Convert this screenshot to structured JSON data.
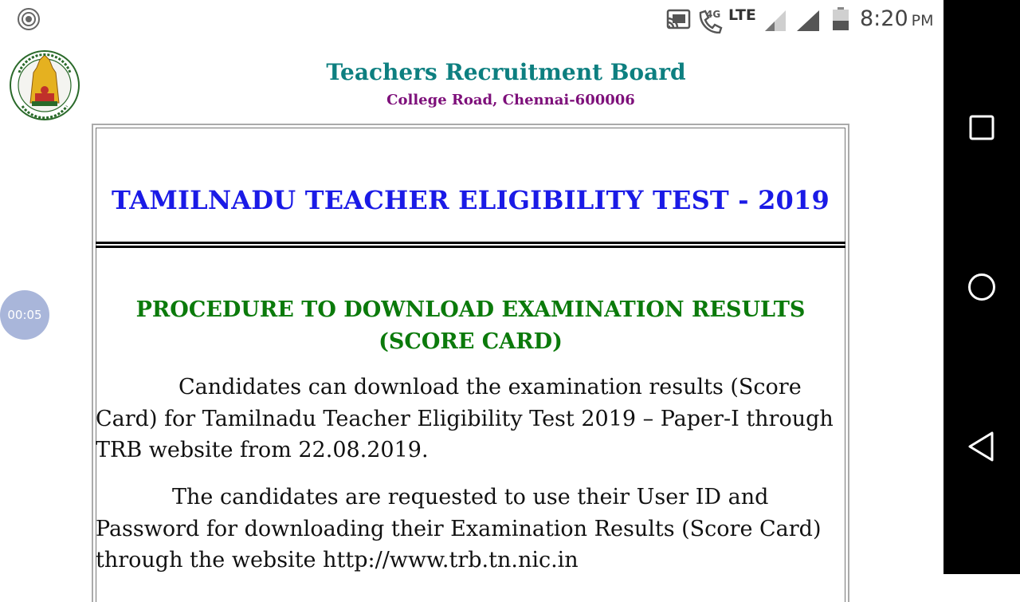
{
  "status_bar": {
    "network_label": "4G",
    "lte_label": "LTE",
    "time": "8:20",
    "ampm": "PM"
  },
  "timer": {
    "label": "00:05"
  },
  "header": {
    "org_title": "Teachers Recruitment Board",
    "org_address": "College Road, Chennai-600006"
  },
  "content": {
    "exam_title": "TAMILNADU TEACHER ELIGIBILITY TEST - 2019",
    "procedure_heading": "PROCEDURE TO DOWNLOAD EXAMINATION RESULTS (SCORE CARD)",
    "paragraph_1": "Candidates can download the examination results (Score Card) for Tamilnadu Teacher Eligibility Test 2019 – Paper-I through TRB website from 22.08.2019.",
    "paragraph_2": "The candidates are requested to use their User ID and Password for downloading their Examination Results (Score Card) through the website http://www.trb.tn.nic.in"
  },
  "colors": {
    "org_title": "#0d7f80",
    "org_address": "#7d0f7a",
    "exam_title": "#1a1ae6",
    "procedure_heading": "#0b7a0b",
    "nav_bar": "#000000",
    "timer_bubble": "#a9b6da"
  },
  "icons": {
    "screen_record": "screen-record-icon",
    "cast": "cast-icon",
    "wifi_call": "wifi-call-icon",
    "signal": "signal-icon",
    "battery": "battery-icon",
    "emblem": "tamilnadu-emblem-icon",
    "nav_square": "recent-apps-icon",
    "nav_circle": "home-icon",
    "nav_back": "back-icon"
  }
}
